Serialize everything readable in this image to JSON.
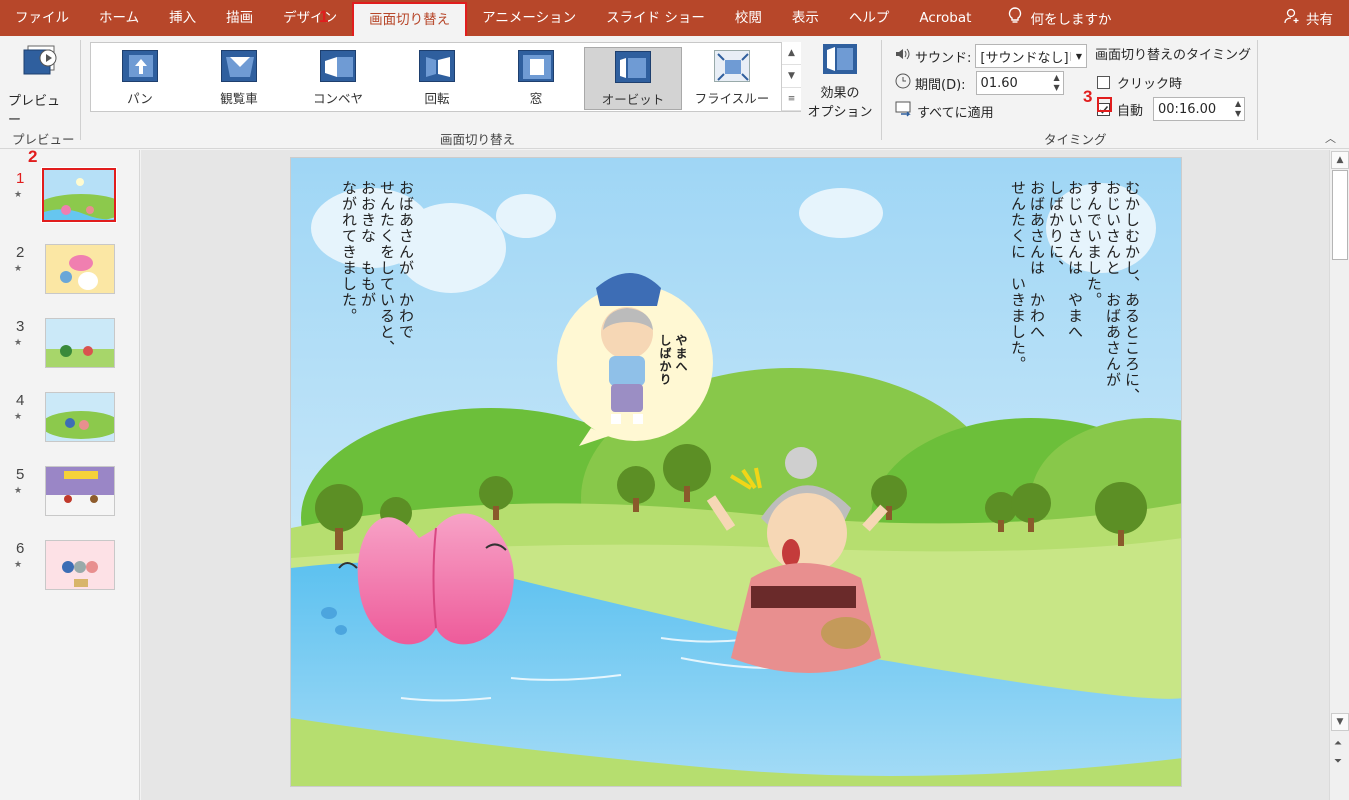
{
  "menubar": {
    "tabs": [
      "ファイル",
      "ホーム",
      "挿入",
      "描画",
      "デザイン",
      "画面切り替え",
      "アニメーション",
      "スライド ショー",
      "校閲",
      "表示",
      "ヘルプ",
      "Acrobat"
    ],
    "tell_me": "何をしますか",
    "share": "共有"
  },
  "callouts": {
    "one": "1",
    "two": "2",
    "three": "3"
  },
  "ribbon": {
    "preview_label": "プレビュー",
    "preview_group": "プレビュー",
    "gallery_items": [
      "パン",
      "観覧車",
      "コンベヤ",
      "回転",
      "窓",
      "オービット",
      "フライスルー"
    ],
    "transitions_group": "画面切り替え",
    "effect_options_line1": "効果の",
    "effect_options_line2": "オプション",
    "sound_label": "サウンド:",
    "sound_value": "[サウンドなし]",
    "duration_label": "期間(D):",
    "duration_value": "01.60",
    "apply_all": "すべてに適用",
    "timing_title": "画面切り替えのタイミング",
    "on_click": "クリック時",
    "auto_label": "自動",
    "auto_value": "00:16.00",
    "timing_group": "タイミング"
  },
  "thumbnails": [
    "1",
    "2",
    "3",
    "4",
    "5",
    "6"
  ],
  "slide": {
    "text_right": "むかしむかし、あるところに、\nおじいさんと　おばあさんが\nすんでいました。\nおじいさんは　やまへ\nしばかりに、\nおばあさんは　かわへ\nせんたくに　いきました。",
    "text_left": "おばあさんが　かわで\nせんたくをしていると、\nおおきな　ももが\nながれてきました。",
    "bubble": "やまへ\nしばかり"
  }
}
